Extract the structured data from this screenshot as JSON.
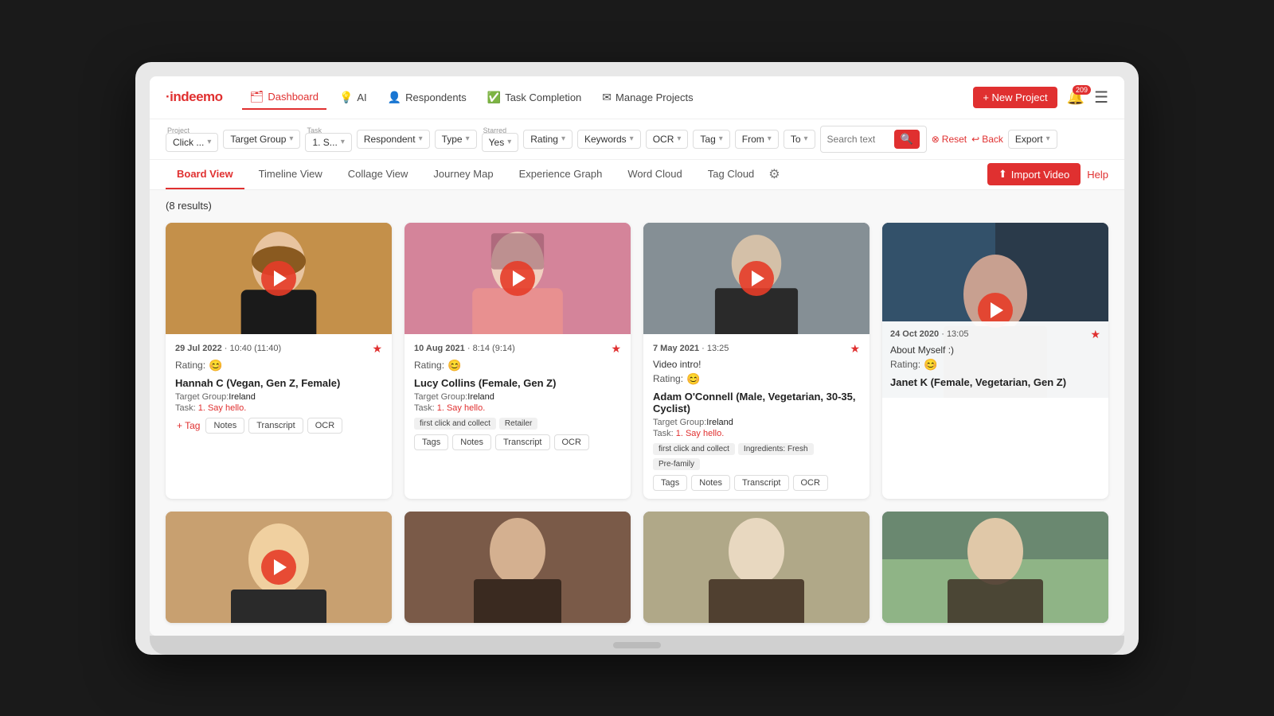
{
  "app": {
    "logo": "·indeemo",
    "notification_count": "209"
  },
  "nav": {
    "items": [
      {
        "id": "dashboard",
        "label": "Dashboard",
        "icon": "🗂",
        "active": true
      },
      {
        "id": "ai",
        "label": "AI",
        "icon": "💡",
        "active": false
      },
      {
        "id": "respondents",
        "label": "Respondents",
        "icon": "👤",
        "active": false
      },
      {
        "id": "task-completion",
        "label": "Task Completion",
        "icon": "✅",
        "active": false
      },
      {
        "id": "manage-projects",
        "label": "Manage Projects",
        "icon": "✉",
        "active": false
      }
    ],
    "new_project": "+ New Project",
    "help": "Help"
  },
  "filters": {
    "project_label": "Project",
    "project_value": "Click ...",
    "task_label": "Task",
    "task_value": "1. S...",
    "target_group_value": "Target Group",
    "respondent_value": "Respondent",
    "type_value": "Type",
    "starred_label": "Starred",
    "starred_value": "Yes",
    "rating_value": "Rating",
    "keywords_value": "Keywords",
    "ocr_value": "OCR",
    "tag_value": "Tag",
    "from_value": "From",
    "to_value": "To",
    "search_placeholder": "Search text",
    "reset_label": "Reset",
    "back_label": "Back",
    "export_label": "Export"
  },
  "view_tabs": {
    "items": [
      {
        "id": "board",
        "label": "Board View",
        "active": true
      },
      {
        "id": "timeline",
        "label": "Timeline View",
        "active": false
      },
      {
        "id": "collage",
        "label": "Collage View",
        "active": false
      },
      {
        "id": "journey",
        "label": "Journey Map",
        "active": false
      },
      {
        "id": "experience",
        "label": "Experience Graph",
        "active": false
      },
      {
        "id": "word-cloud",
        "label": "Word Cloud",
        "active": false
      },
      {
        "id": "tag-cloud",
        "label": "Tag Cloud",
        "active": false
      }
    ],
    "import_label": "Import Video"
  },
  "results": {
    "count": "(8 results)"
  },
  "cards": [
    {
      "id": "card1",
      "date": "29 Jul 2022",
      "time": "10:40 (11:40)",
      "starred": true,
      "rating_emoji": "😊",
      "name": "Hannah C (Vegan, Gen Z, Female)",
      "target_group": "Ireland",
      "task": "1. Say hello.",
      "tags": [],
      "actions": [
        "+ Tag",
        "Notes",
        "Transcript",
        "OCR"
      ],
      "thumb_class": "thumb-warm"
    },
    {
      "id": "card2",
      "date": "10 Aug 2021",
      "time": "8:14 (9:14)",
      "starred": true,
      "rating_emoji": "😊",
      "name": "Lucy Collins (Female, Gen Z)",
      "target_group": "Ireland",
      "task": "1. Say hello.",
      "tags": [
        "first click and collect",
        "Retailer"
      ],
      "actions": [
        "Tags",
        "Notes",
        "Transcript",
        "OCR"
      ],
      "thumb_class": "thumb-pink"
    },
    {
      "id": "card3",
      "date": "7 May 2021",
      "time": "13:25",
      "starred": true,
      "video_intro": "Video intro!",
      "rating_emoji": "😊",
      "name": "Adam O'Connell (Male, Vegetarian, 30-35, Cyclist)",
      "target_group": "Ireland",
      "task": "1. Say hello.",
      "tags": [
        "first click and collect",
        "Ingredients: Fresh",
        "Pre-family"
      ],
      "actions": [
        "Tags",
        "Notes",
        "Transcript",
        "OCR"
      ],
      "thumb_class": "thumb-dark"
    },
    {
      "id": "card4",
      "date": "24 Oct 2020",
      "time": "13:05",
      "starred": true,
      "video_intro": "About Myself :)",
      "rating_emoji": "😊",
      "name": "Janet K (Female, Vegetarian, Gen Z)",
      "target_group": "",
      "task": "",
      "tags": [],
      "actions": [],
      "thumb_class": "thumb-dark2"
    },
    {
      "id": "card5",
      "date": "",
      "time": "",
      "starred": false,
      "name": "",
      "target_group": "",
      "task": "",
      "tags": [],
      "actions": [],
      "thumb_class": "thumb-warm"
    },
    {
      "id": "card6",
      "date": "",
      "time": "",
      "starred": false,
      "name": "",
      "target_group": "",
      "task": "",
      "tags": [],
      "actions": [],
      "thumb_class": "thumb-brown"
    },
    {
      "id": "card7",
      "date": "",
      "time": "",
      "starred": false,
      "name": "",
      "target_group": "",
      "task": "",
      "tags": [],
      "actions": [],
      "thumb_class": "thumb-cream"
    },
    {
      "id": "card8",
      "date": "",
      "time": "",
      "starred": false,
      "name": "",
      "target_group": "",
      "task": "",
      "tags": [],
      "actions": [],
      "thumb_class": "thumb-green"
    }
  ]
}
